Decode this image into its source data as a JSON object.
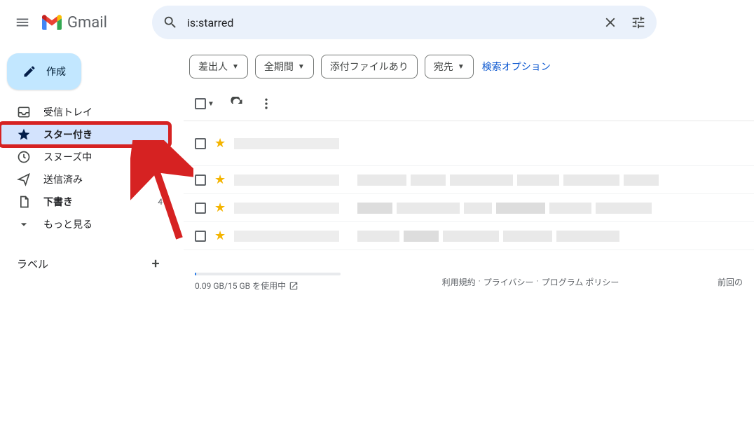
{
  "header": {
    "product_name": "Gmail",
    "search_value": "is:starred"
  },
  "compose": {
    "label": "作成"
  },
  "sidebar": {
    "items": [
      {
        "icon": "inbox",
        "label": "受信トレイ",
        "bold": false
      },
      {
        "icon": "star",
        "label": "スター付き",
        "active": true,
        "highlight": true
      },
      {
        "icon": "clock",
        "label": "スヌーズ中"
      },
      {
        "icon": "send",
        "label": "送信済み"
      },
      {
        "icon": "draft",
        "label": "下書き",
        "bold": true,
        "count": "4"
      },
      {
        "icon": "more",
        "label": "もっと見る"
      }
    ],
    "labels_heading": "ラベル"
  },
  "chips": [
    {
      "label": "差出人",
      "arrow": true
    },
    {
      "label": "全期間",
      "arrow": true
    },
    {
      "label": "添付ファイルあり",
      "arrow": false
    },
    {
      "label": "宛先",
      "arrow": true
    }
  ],
  "advanced_search": "検索オプション",
  "footer": {
    "storage_text": "0.09 GB/15 GB を使用中",
    "terms": "利用規約",
    "privacy": "プライバシー",
    "policy": "プログラム ポリシー",
    "dot": " · ",
    "last_activity_prefix": "前回の"
  }
}
